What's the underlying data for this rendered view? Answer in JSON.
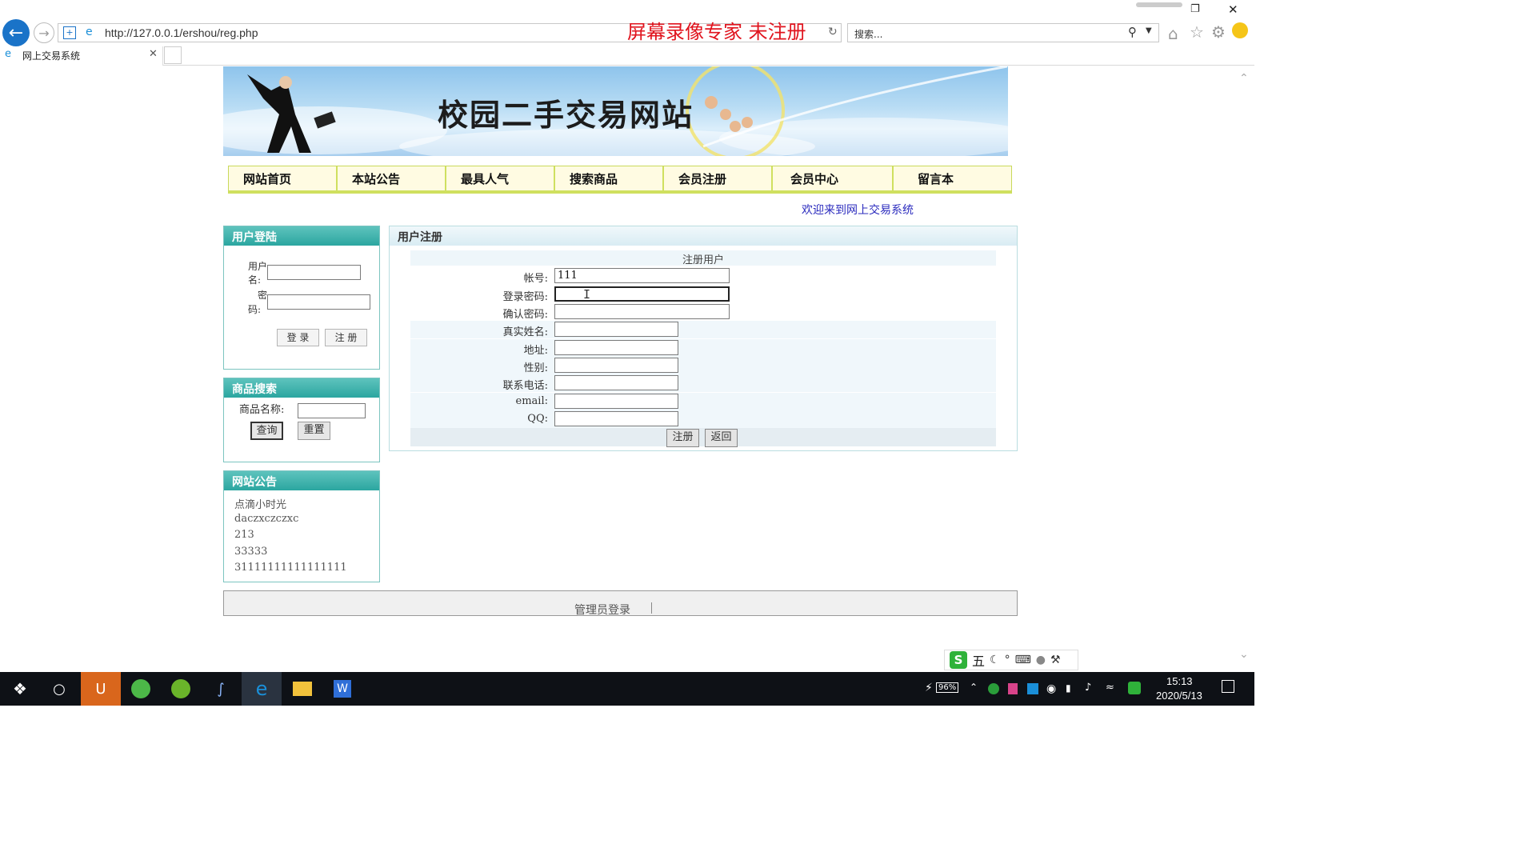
{
  "browser": {
    "url": "http://127.0.0.1/ershou/reg.php",
    "watermark": "屏幕录像专家  未注册",
    "search_placeholder": "搜索...",
    "tab_title": "网上交易系统"
  },
  "site": {
    "banner_title": "校园二手交易网站",
    "nav": [
      "网站首页",
      "本站公告",
      "最具人气",
      "搜索商品",
      "会员注册",
      "会员中心",
      "留言本"
    ],
    "welcome": "欢迎来到网上交易系统"
  },
  "login_panel": {
    "title": "用户登陆",
    "username_label_1": "用户",
    "username_label_2": "名:",
    "password_label_1": "密",
    "password_label_2": "码:",
    "login_btn": "登  录",
    "register_btn": "注  册"
  },
  "search_panel": {
    "title": "商品搜索",
    "name_label": "商品名称:",
    "query_btn": "查询",
    "reset_btn": "重置"
  },
  "notice_panel": {
    "title": "网站公告",
    "items": [
      "点滴小时光",
      "daczxczczxc",
      "213",
      "33333",
      "31111111111111111"
    ]
  },
  "register": {
    "panel_title": "用户注册",
    "form_title": "注册用户",
    "fields": [
      {
        "label": "帐号:",
        "value": "111"
      },
      {
        "label": "登录密码:",
        "value": ""
      },
      {
        "label": "确认密码:",
        "value": ""
      },
      {
        "label": "真实姓名:",
        "value": ""
      },
      {
        "label": "地址:",
        "value": ""
      },
      {
        "label": "性别:",
        "value": ""
      },
      {
        "label": "联系电话:",
        "value": ""
      },
      {
        "label": "email:",
        "value": ""
      },
      {
        "label": "QQ:",
        "value": ""
      }
    ],
    "submit_btn": "注册",
    "back_btn": "返回"
  },
  "footer": {
    "admin_link": "管理员登录"
  },
  "ime": {
    "mode": "五"
  },
  "taskbar": {
    "battery": "96%",
    "time": "15:13",
    "date": "2020/5/13"
  }
}
